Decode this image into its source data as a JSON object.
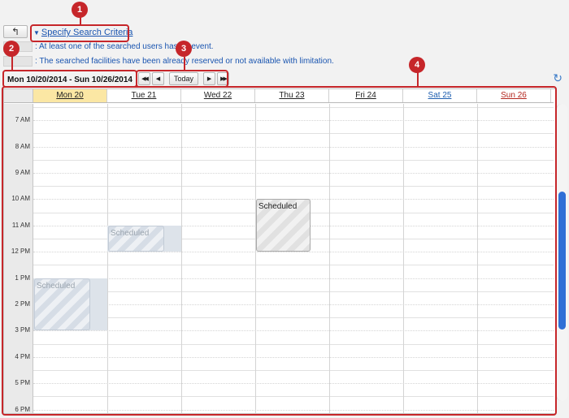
{
  "toolbar": {
    "back_icon": "back-arrow-icon",
    "back_glyph": "↰",
    "criteria_label": "Specify Search Criteria",
    "criteria_glyph": "▼"
  },
  "legend": {
    "busy_text": ": At least one of the searched users has an event.",
    "facility_text": ": The searched facilities have been already reserved or not available with limitation."
  },
  "navigation": {
    "date_range": "Mon 10/20/2014 - Sun 10/26/2014",
    "first_glyph": "◀◀",
    "prev_glyph": "◀",
    "today_label": "Today",
    "next_glyph": "▶",
    "last_glyph": "▶▶",
    "refresh_glyph": "↻"
  },
  "calendar": {
    "days": [
      "Mon 20",
      "Tue 21",
      "Wed 22",
      "Thu 23",
      "Fri 24",
      "Sat 25",
      "Sun 26"
    ],
    "times": [
      "7 AM",
      "8 AM",
      "9 AM",
      "10 AM",
      "11 AM",
      "12 PM",
      "1 PM",
      "2 PM",
      "3 PM",
      "4 PM",
      "5 PM",
      "6 PM"
    ],
    "events": [
      {
        "day": "Mon 20",
        "start": "1 PM",
        "end": "3 PM",
        "label": "Scheduled",
        "state": "faded"
      },
      {
        "day": "Tue 21",
        "start": "11 AM",
        "end": "12 PM",
        "label": "Scheduled",
        "state": "faded"
      },
      {
        "day": "Thu 23",
        "start": "10 AM",
        "end": "12 PM",
        "label": "Scheduled",
        "state": "busy"
      }
    ]
  },
  "callouts": [
    "1",
    "2",
    "3",
    "4"
  ],
  "colors": {
    "accent_red": "#c6262a",
    "link_blue": "#1a55b0",
    "today_highlight": "#fbe7a4",
    "saturday": "#1f5fb0",
    "sunday": "#b3261e",
    "scrollbar": "#2f6fd6"
  }
}
